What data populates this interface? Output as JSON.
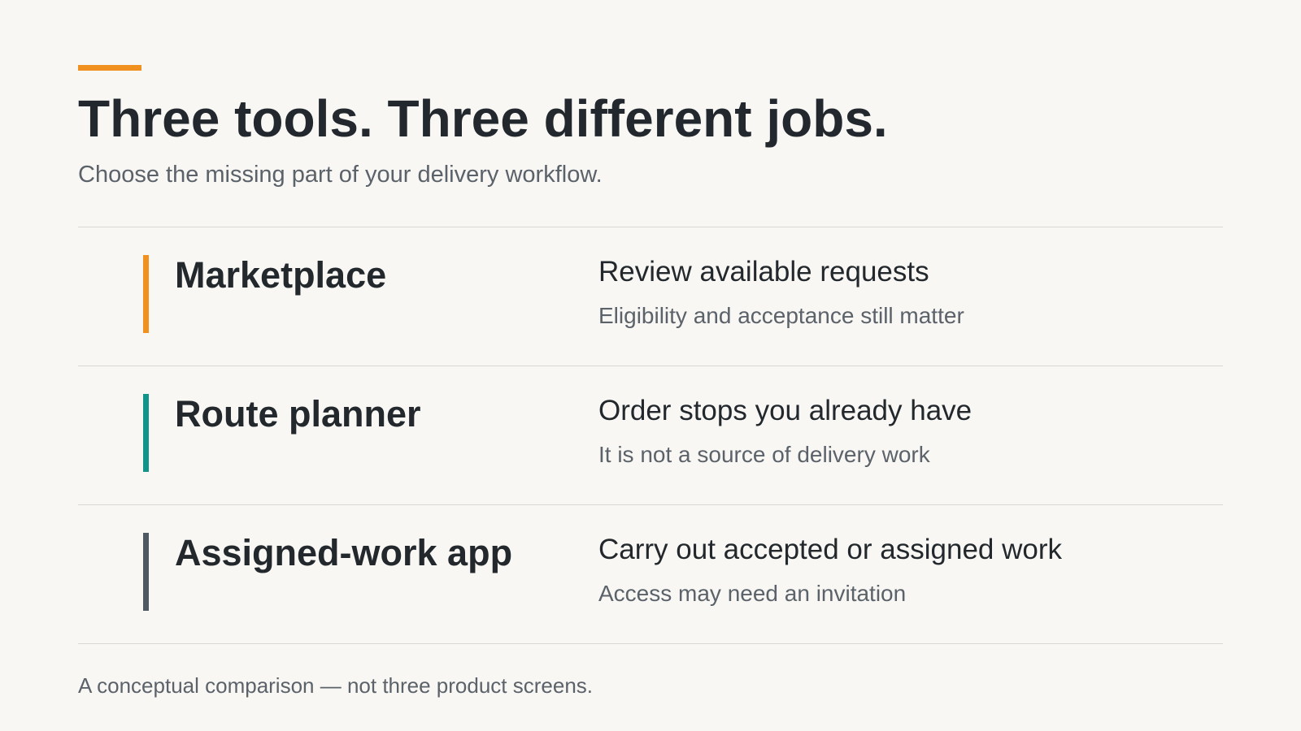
{
  "slide": {
    "title": "Three tools. Three different jobs.",
    "subtitle": "Choose the missing part of your delivery workflow.",
    "accent_color": "#f0911f",
    "footnote": "A conceptual comparison — not three product screens."
  },
  "tools": [
    {
      "name": "Marketplace",
      "job": "Review available requests",
      "note": "Eligibility and acceptance still matter",
      "color": "#f0911f"
    },
    {
      "name": "Route planner",
      "job": "Order stops you already have",
      "note": "It is not a source of delivery work",
      "color": "#13948b"
    },
    {
      "name": "Assigned-work app",
      "job": "Carry out accepted or assigned work",
      "note": "Access may need an invitation",
      "color": "#4f5961"
    }
  ]
}
